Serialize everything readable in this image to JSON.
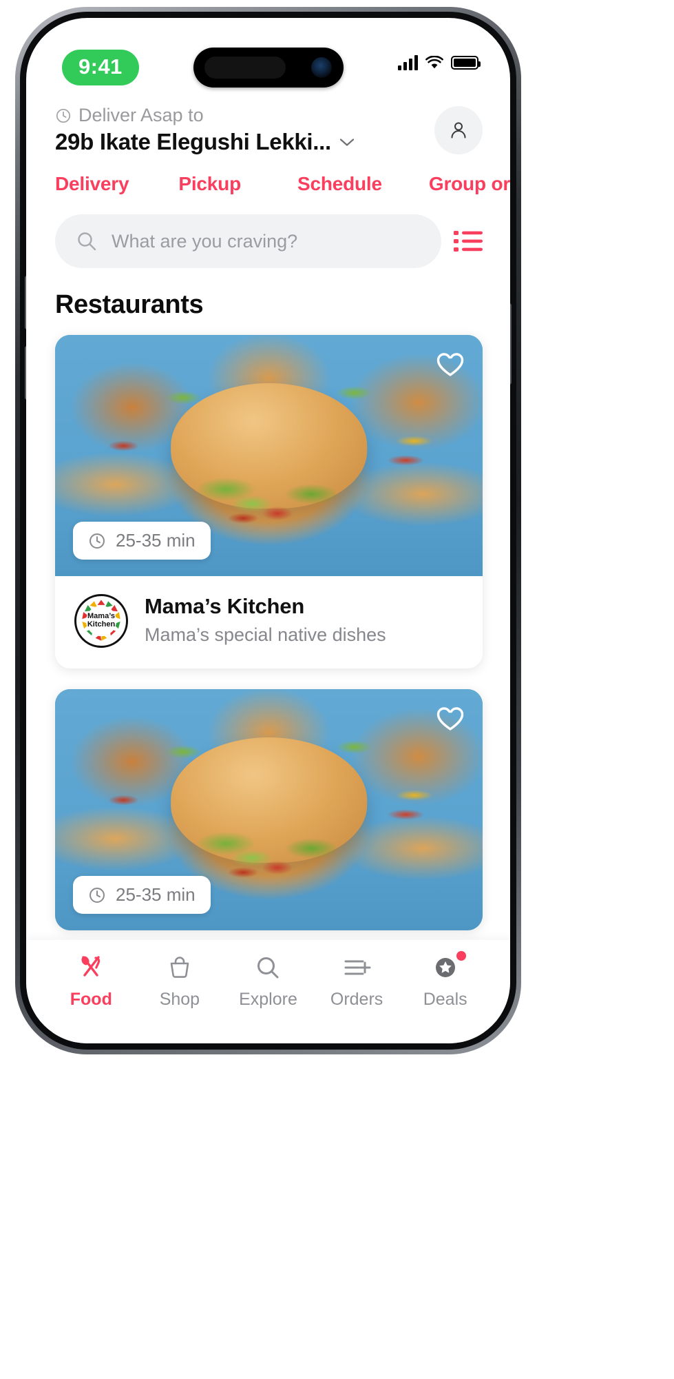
{
  "status_bar": {
    "time": "9:41",
    "signal_icon": "cellular-signal-icon",
    "wifi_icon": "wifi-icon",
    "battery_icon": "battery-icon"
  },
  "header": {
    "clock_icon": "clock-icon",
    "deliver_label": "Deliver Asap to",
    "address": "29b Ikate Elegushi Lekki...",
    "chevron_icon": "chevron-down-icon",
    "account_icon": "user-account-icon"
  },
  "tabs": [
    {
      "label": "Delivery",
      "active": true
    },
    {
      "label": "Pickup",
      "active": false
    },
    {
      "label": "Schedule",
      "active": false
    },
    {
      "label": "Group order",
      "active": false
    }
  ],
  "search": {
    "placeholder": "What are you craving?",
    "search_icon": "search-icon",
    "list_icon": "list-view-icon"
  },
  "section": {
    "title": "Restaurants"
  },
  "restaurants": [
    {
      "name": "Mama’s Kitchen",
      "description": "Mama’s special native dishes",
      "delivery_time": "25-35 min",
      "clock_icon": "clock-icon",
      "favorite_icon": "heart-icon",
      "logo_line1": "Mama’s",
      "logo_line2": "Kitchen"
    },
    {
      "name": "",
      "description": "",
      "delivery_time": "25-35 min",
      "clock_icon": "clock-icon",
      "favorite_icon": "heart-icon",
      "logo_line1": "",
      "logo_line2": ""
    }
  ],
  "bottom_nav": [
    {
      "label": "Food",
      "icon": "food-utensils-icon",
      "active": true,
      "badge": false
    },
    {
      "label": "Shop",
      "icon": "shopping-basket-icon",
      "active": false,
      "badge": false
    },
    {
      "label": "Explore",
      "icon": "search-icon",
      "active": false,
      "badge": false
    },
    {
      "label": "Orders",
      "icon": "orders-list-plus-icon",
      "active": false,
      "badge": false
    },
    {
      "label": "Deals",
      "icon": "star-badge-icon",
      "active": false,
      "badge": true
    }
  ],
  "colors": {
    "accent": "#fa3e5d",
    "muted_text": "#8e9095",
    "search_bg": "#f1f2f4",
    "status_green": "#32cb5a"
  }
}
